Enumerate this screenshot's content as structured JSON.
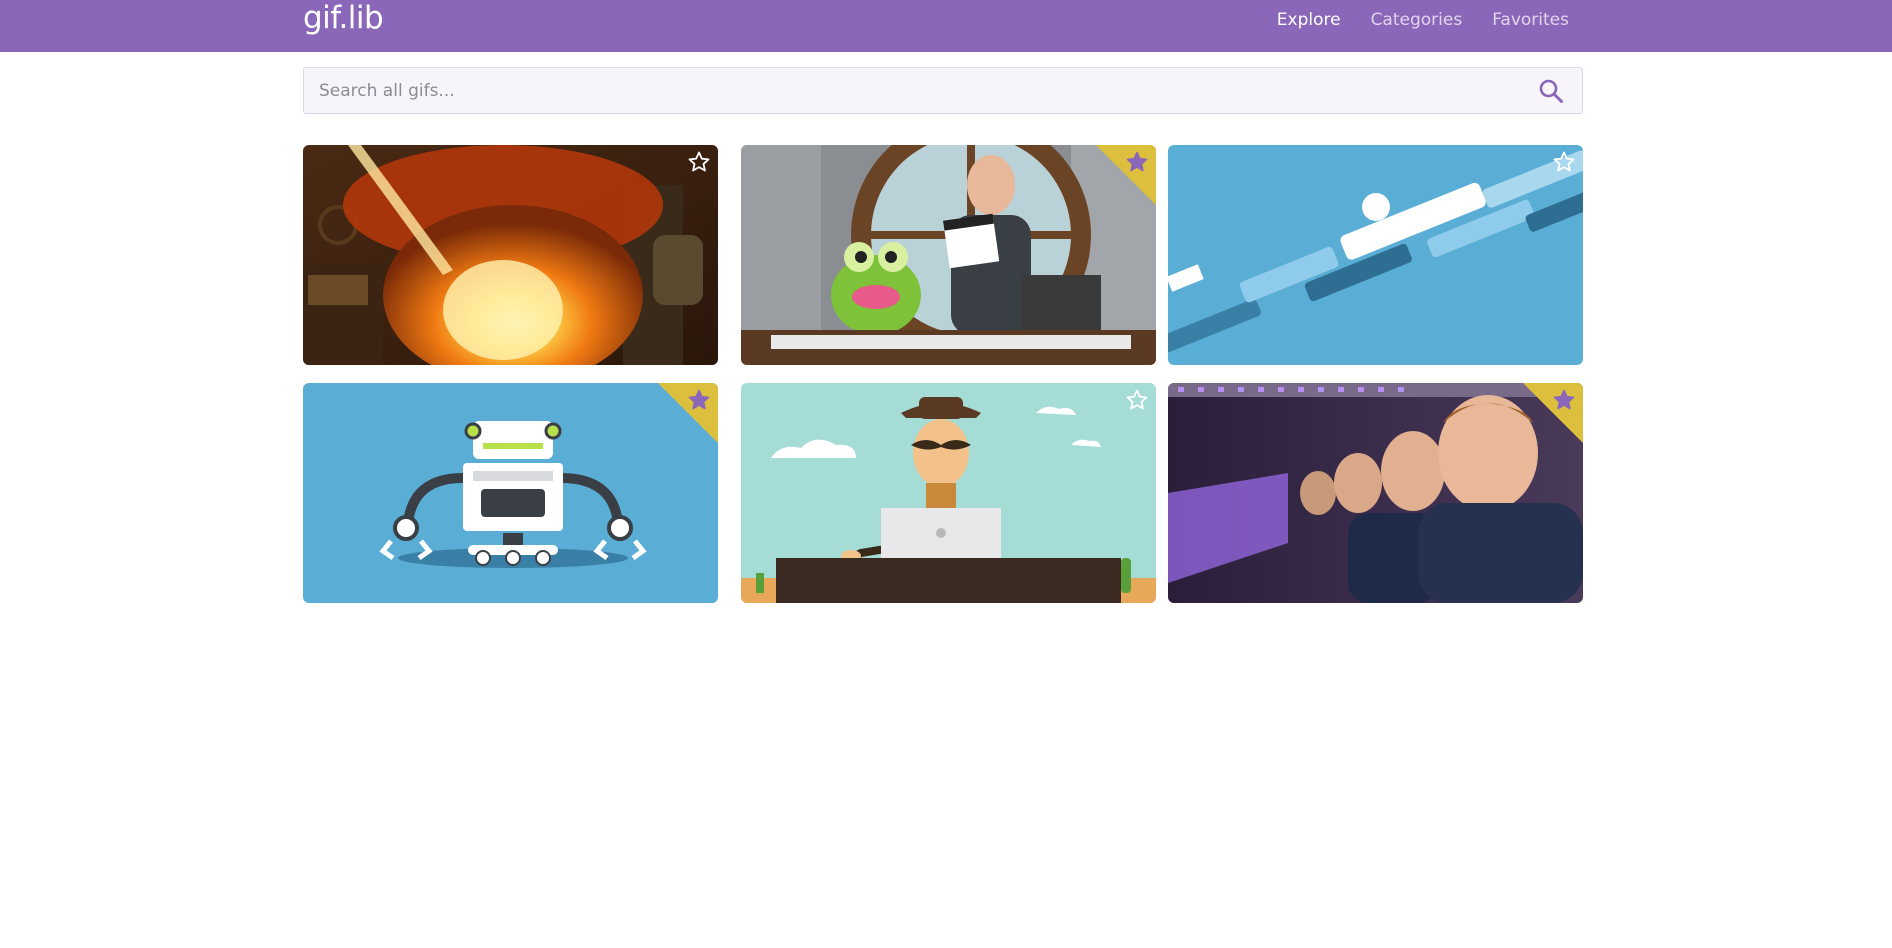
{
  "navbar": {
    "brand": "gif.lib",
    "links": [
      {
        "label": "Explore",
        "active": true
      },
      {
        "label": "Categories",
        "active": false
      },
      {
        "label": "Favorites",
        "active": false
      }
    ]
  },
  "search": {
    "placeholder": "Search all gifs..."
  },
  "colors": {
    "navbar": "#8a67b8",
    "favorite_ribbon": "#dcc03d",
    "favorite_star": "#8a67b8"
  },
  "gifs": [
    {
      "scene": "fire-explosion",
      "favorite": false
    },
    {
      "scene": "host-with-frog-and-clapperboard",
      "favorite": true
    },
    {
      "scene": "blue-abstract-bars",
      "favorite": false
    },
    {
      "scene": "robot",
      "favorite": true
    },
    {
      "scene": "cowboy-at-laptop",
      "favorite": false
    },
    {
      "scene": "infinite-mirror-man",
      "favorite": true
    }
  ]
}
